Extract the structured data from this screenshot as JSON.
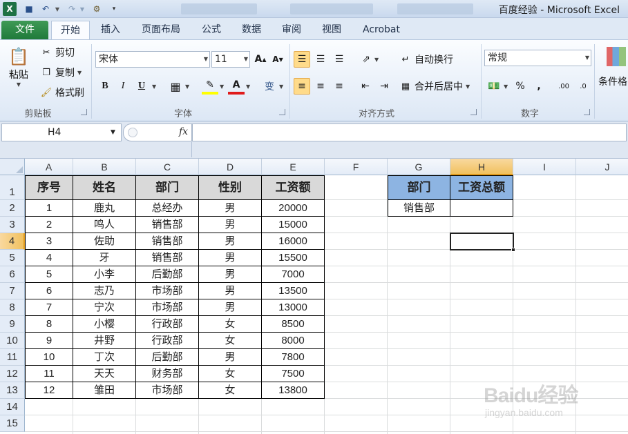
{
  "window": {
    "title": "百度经验 - Microsoft Excel"
  },
  "tabs": [
    "文件",
    "开始",
    "插入",
    "页面布局",
    "公式",
    "数据",
    "审阅",
    "视图",
    "Acrobat"
  ],
  "ribbon": {
    "clipboard": {
      "paste": "粘贴",
      "cut": "剪切",
      "copy": "复制",
      "format_painter": "格式刷",
      "label": "剪贴板"
    },
    "font": {
      "name": "宋体",
      "size": "11",
      "grow": "A",
      "shrink": "A",
      "bold": "B",
      "italic": "I",
      "underline": "U",
      "font_color": "A",
      "phonetic": "变",
      "label": "字体"
    },
    "alignment": {
      "wrap": "自动换行",
      "merge": "合并后居中",
      "label": "对齐方式"
    },
    "number": {
      "format": "常规",
      "percent": "%",
      "comma": ",",
      "inc": ".00",
      "dec": ".0",
      "label": "数字"
    },
    "styles": {
      "conditional": "条件格"
    }
  },
  "formula_bar": {
    "name_box": "H4",
    "fx": "fx",
    "value": ""
  },
  "columns": [
    "A",
    "B",
    "C",
    "D",
    "E",
    "F",
    "G",
    "H",
    "I",
    "J"
  ],
  "rows": [
    "1",
    "2",
    "3",
    "4",
    "5",
    "6",
    "7",
    "8",
    "9",
    "10",
    "11",
    "12",
    "13",
    "14",
    "15"
  ],
  "table": {
    "headers": [
      "序号",
      "姓名",
      "部门",
      "性别",
      "工资额"
    ],
    "rows": [
      [
        "1",
        "鹿丸",
        "总经办",
        "男",
        "20000"
      ],
      [
        "2",
        "鸣人",
        "销售部",
        "男",
        "15000"
      ],
      [
        "3",
        "佐助",
        "销售部",
        "男",
        "16000"
      ],
      [
        "4",
        "牙",
        "销售部",
        "男",
        "15500"
      ],
      [
        "5",
        "小李",
        "后勤部",
        "男",
        "7000"
      ],
      [
        "6",
        "志乃",
        "市场部",
        "男",
        "13500"
      ],
      [
        "7",
        "宁次",
        "市场部",
        "男",
        "13000"
      ],
      [
        "8",
        "小樱",
        "行政部",
        "女",
        "8500"
      ],
      [
        "9",
        "井野",
        "行政部",
        "女",
        "8000"
      ],
      [
        "10",
        "丁次",
        "后勤部",
        "男",
        "7800"
      ],
      [
        "11",
        "天天",
        "财务部",
        "女",
        "7500"
      ],
      [
        "12",
        "雏田",
        "市场部",
        "女",
        "13800"
      ]
    ]
  },
  "summary": {
    "headers": [
      "部门",
      "工资总额"
    ],
    "dept": "销售部",
    "total": ""
  },
  "watermark": {
    "logo": "Baidu经验",
    "url": "jingyan.baidu.com"
  },
  "colors": {
    "header_fill": "#d9d9d9",
    "summary_header_fill": "#8db4e2",
    "selected_header": "#f1c15f",
    "file_tab": "#1f7a3a"
  }
}
